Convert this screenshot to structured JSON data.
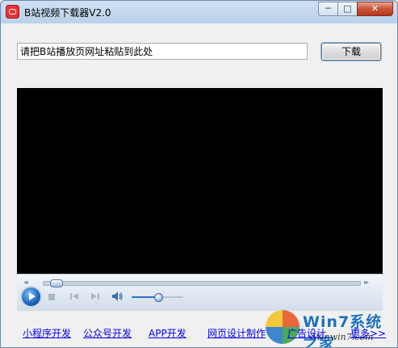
{
  "window": {
    "title": "B站视频下载器V2.0",
    "controls": {
      "minimize": "─",
      "maximize": "□",
      "close": "✕"
    }
  },
  "url_input": {
    "value": "请把B站播放页网址粘贴到此处"
  },
  "download_button": {
    "label": "下载"
  },
  "player": {
    "seek_position": 0.02,
    "volume_level": 0.5,
    "seek_left_arrow": "◂◂",
    "seek_right_arrow": "▸▸"
  },
  "links": [
    {
      "label": "小程序开发"
    },
    {
      "label": "公众号开发"
    },
    {
      "label": "APP开发"
    },
    {
      "label": "网页设计制作"
    },
    {
      "label": "广告设计"
    },
    {
      "label": "更多>>"
    }
  ],
  "watermark": {
    "title": "Win7系统之家",
    "subtitle": "Winwin7.com"
  },
  "icons": [
    "app-icon",
    "minimize-icon",
    "maximize-icon",
    "close-icon",
    "play-icon",
    "stop-icon",
    "previous-icon",
    "next-icon",
    "volume-icon"
  ]
}
